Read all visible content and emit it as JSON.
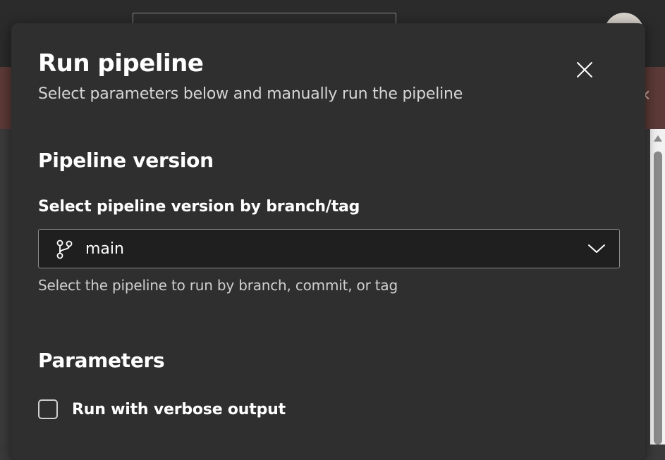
{
  "dialog": {
    "title": "Run pipeline",
    "subtitle": "Select parameters below and manually run the pipeline",
    "close_icon": "close-icon"
  },
  "pipeline_version": {
    "heading": "Pipeline version",
    "field_label": "Select pipeline version by branch/tag",
    "selected_branch": "main",
    "branch_icon": "git-branch-icon",
    "dropdown_icon": "chevron-down-icon",
    "help_text": "Select the pipeline to run by branch, commit, or tag"
  },
  "parameters": {
    "heading": "Parameters",
    "options": [
      {
        "label": "Run with verbose output",
        "checked": false
      }
    ]
  },
  "colors": {
    "dialog_background": "#2f2f2f",
    "dropdown_background": "#1f1f1f",
    "banner_background": "#5c3a37"
  }
}
